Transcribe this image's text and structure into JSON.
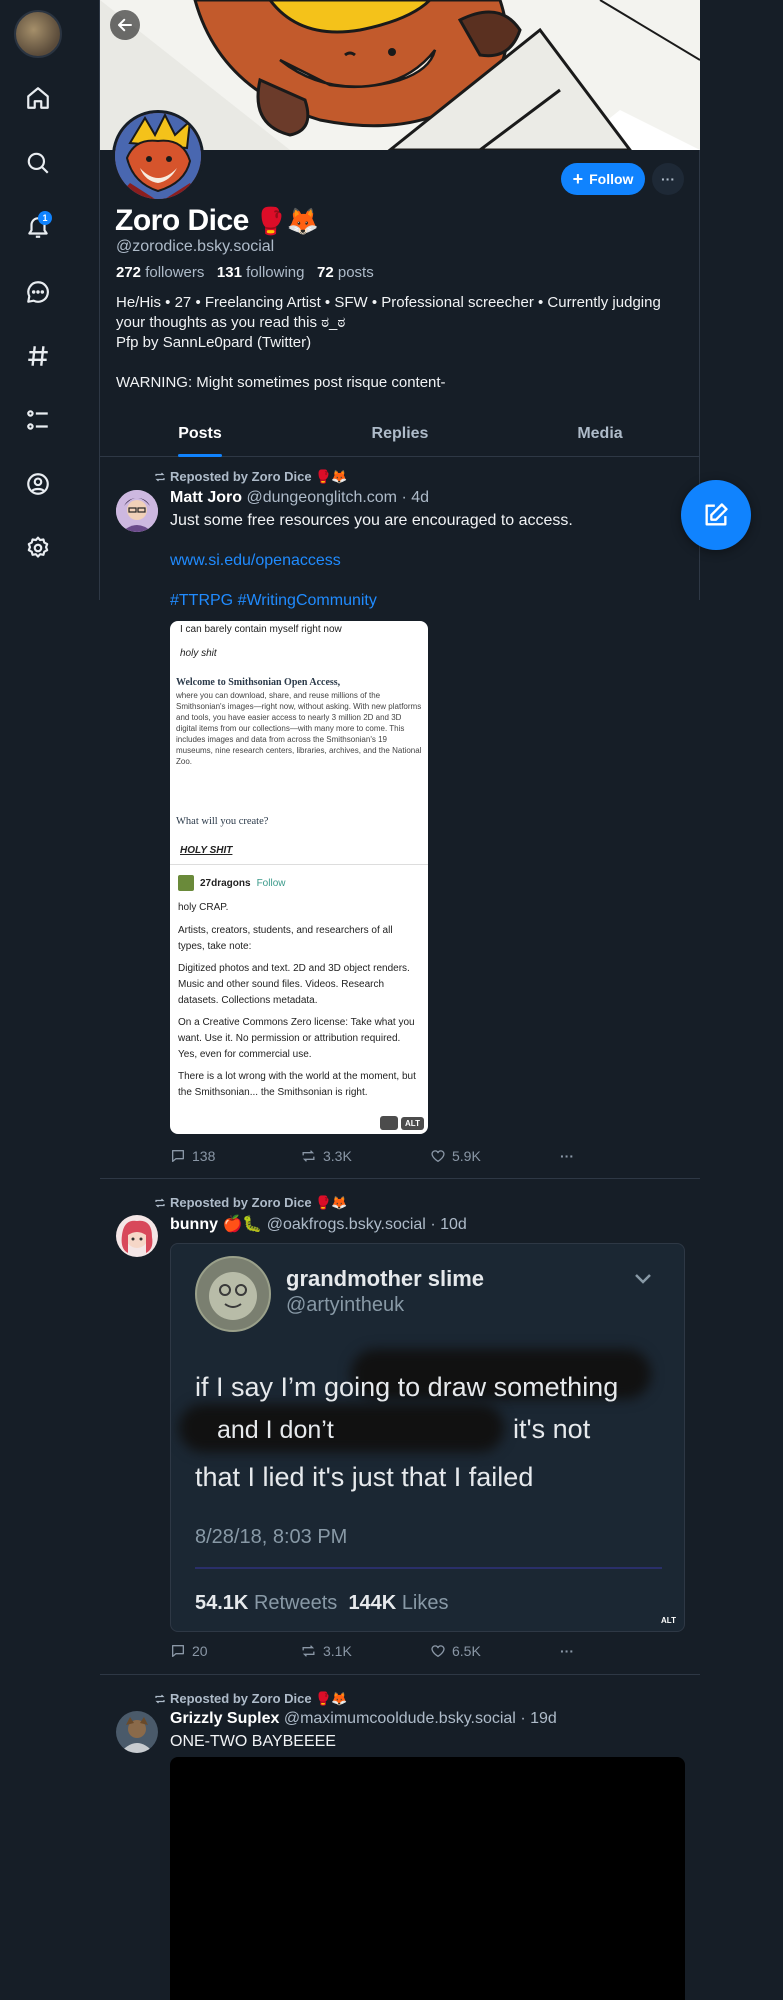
{
  "colors": {
    "accent": "#1083fe",
    "link": "#208bfe",
    "background": "#161e27"
  },
  "sidebar": {
    "items": [
      {
        "name": "home-icon"
      },
      {
        "name": "search-icon"
      },
      {
        "name": "notifications-icon",
        "badge": "1"
      },
      {
        "name": "chat-icon"
      },
      {
        "name": "feeds-hash-icon"
      },
      {
        "name": "lists-icon"
      },
      {
        "name": "profile-icon"
      },
      {
        "name": "settings-icon"
      }
    ]
  },
  "profile": {
    "display_name": "Zoro Dice",
    "name_emoji": "🥊🦊",
    "handle": "@zorodice.bsky.social",
    "followers_count": "272",
    "followers_label": "followers",
    "following_count": "131",
    "following_label": "following",
    "posts_count": "72",
    "posts_label": "posts",
    "bio": "He/His • 27 • Freelancing Artist • SFW • Professional screecher • Currently judging your thoughts as you read this ಠ_ಠ\nPfp by SannLe0pard (Twitter)\n\nWARNING: Might sometimes post risque content-",
    "follow_label": "Follow"
  },
  "tabs": [
    {
      "label": "Posts",
      "active": true
    },
    {
      "label": "Replies",
      "active": false
    },
    {
      "label": "Media",
      "active": false
    }
  ],
  "posts": [
    {
      "repost_label": "Reposted by Zoro Dice 🥊🦊",
      "author_name": "Matt Joro",
      "author_handle": "@dungeonglitch.com",
      "time": "· 4d",
      "text": "Just some free resources you are encouraged to access.",
      "link": "www.si.edu/openaccess",
      "hashtags": "#TTRPG #WritingCommunity",
      "image": {
        "line1": "I can barely contain myself right now",
        "line2": "holy shit",
        "welcome_title": "Welcome to Smithsonian Open Access,",
        "welcome_body": "where you can download, share, and reuse millions of the Smithsonian's images—right now, without asking. With new platforms and tools, you have easier access to nearly 3 million 2D and 3D digital items from our collections—with many more to come. This includes images and data from across the Smithsonian's 19 museums, nine research centers, libraries, archives, and the National Zoo.",
        "question": "What will you create?",
        "holy": "HOLY SHIT",
        "reply_user": "27dragons",
        "reply_follow": "Follow",
        "r1": "holy CRAP.",
        "r2": "Artists, creators, students, and researchers of all types, take note:",
        "r3": "Digitized photos and text. 2D and 3D object renders. Music and other sound files. Videos. Research datasets. Collections metadata.",
        "r4": "On a Creative Commons Zero license: Take what you want. Use it. No permission or attribution required. Yes, even for commercial use.",
        "r5": "There is a lot wrong with the world at the moment, but the Smithsonian... the Smithsonian is right.",
        "alt": "ALT"
      },
      "replies": "138",
      "reposts": "3.3K",
      "likes": "5.9K"
    },
    {
      "repost_label": "Reposted by Zoro Dice 🥊🦊",
      "author_name": "bunny 🍎🐛",
      "author_handle": "@oakfrogs.bsky.social",
      "time": "· 10d",
      "tweet": {
        "name": "grandmother slime",
        "handle": "@artyintheuk",
        "l1a": "if I say",
        "l1b": "I’m going to draw something",
        "l2a": "and I don’t",
        "l2b": "it's not",
        "l3": "that I lied it's just that I failed",
        "timestamp": "8/28/18, 8:03 PM",
        "retweets_count": "54.1K",
        "retweets_label": "Retweets",
        "likes_count": "144K",
        "likes_label": "Likes",
        "alt": "ALT"
      },
      "replies": "20",
      "reposts": "3.1K",
      "likes": "6.5K"
    },
    {
      "repost_label": "Reposted by Zoro Dice 🥊🦊",
      "author_name": "Grizzly Suplex",
      "author_handle": "@maximumcooldude.bsky.social",
      "time": "· 19d",
      "text": "ONE-TWO BAYBEEEE"
    }
  ]
}
